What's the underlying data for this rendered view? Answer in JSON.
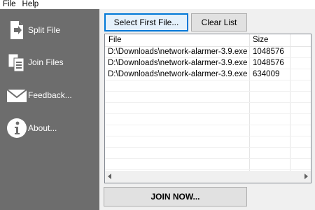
{
  "menu": {
    "file": "File",
    "help": "Help"
  },
  "sidebar": {
    "items": [
      {
        "label": "Split File",
        "icon": "document-arrow-icon"
      },
      {
        "label": "Join Files",
        "icon": "files-merge-icon"
      },
      {
        "label": "Feedback...",
        "icon": "envelope-icon"
      },
      {
        "label": "About...",
        "icon": "info-icon"
      }
    ]
  },
  "toolbar": {
    "select_first": "Select First File...",
    "clear_list": "Clear List"
  },
  "list": {
    "headers": {
      "file": "File",
      "size": "Size"
    },
    "rows": [
      {
        "file": "D:\\Downloads\\network-alarmer-3.9.exe....",
        "size": "1048576"
      },
      {
        "file": "D:\\Downloads\\network-alarmer-3.9.exe....",
        "size": "1048576"
      },
      {
        "file": "D:\\Downloads\\network-alarmer-3.9.exe....",
        "size": "634009"
      }
    ]
  },
  "join_button": "JOIN NOW...",
  "colors": {
    "sidebar": "#6d6d6d",
    "focus": "#0078d7",
    "button": "#e1e1e1"
  }
}
